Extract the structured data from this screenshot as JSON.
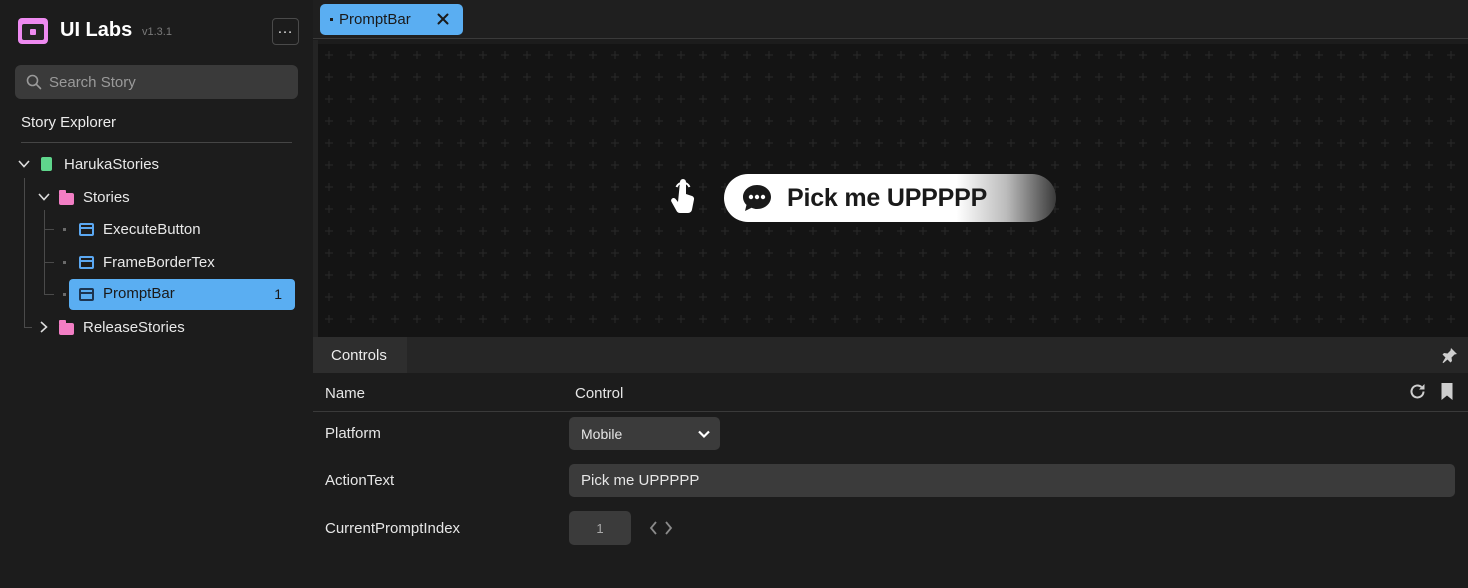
{
  "app": {
    "title": "UI Labs",
    "version": "v1.3.1",
    "menu_label": "…"
  },
  "search": {
    "placeholder": "Search Story"
  },
  "explorer": {
    "title": "Story Explorer",
    "root": "HarukaStories",
    "folder_stories": "Stories",
    "items": [
      {
        "label": "ExecuteButton"
      },
      {
        "label": "FrameBorderTex"
      },
      {
        "label": "PromptBar",
        "count": "1"
      }
    ],
    "folder_release": "ReleaseStories"
  },
  "tabs": [
    {
      "label": "PromptBar"
    }
  ],
  "preview": {
    "prompt_text": "Pick me UPPPPP"
  },
  "controls": {
    "tab_label": "Controls",
    "col_name": "Name",
    "col_control": "Control",
    "rows": [
      {
        "name": "Platform",
        "value": "Mobile"
      },
      {
        "name": "ActionText",
        "value": "Pick me UPPPPP"
      },
      {
        "name": "CurrentPromptIndex",
        "value": "1"
      }
    ]
  },
  "colors": {
    "accent": "#5aaef2",
    "logo": "#ee8af0",
    "folder": "#f27ec4",
    "root_book": "#5fd68c"
  }
}
